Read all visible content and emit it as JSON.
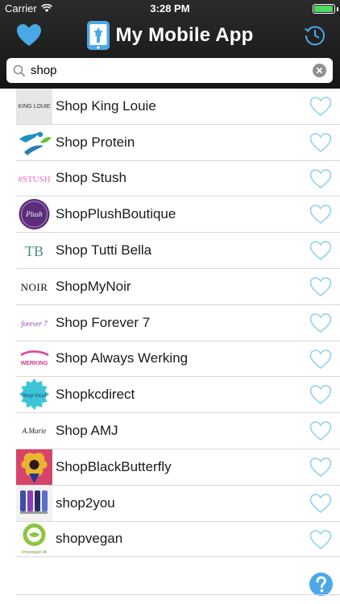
{
  "status": {
    "carrier": "Carrier",
    "time": "3:28 PM",
    "battery_level": 0.95
  },
  "header": {
    "title": "My Mobile App"
  },
  "search": {
    "value": "shop",
    "placeholder": ""
  },
  "results": [
    {
      "label": "Shop King Louie",
      "thumb_text": "KING LOUIE"
    },
    {
      "label": "Shop Protein",
      "thumb_text": ""
    },
    {
      "label": "Shop Stush",
      "thumb_text": "#STUSH"
    },
    {
      "label": "ShopPlushBoutique",
      "thumb_text": "Plush"
    },
    {
      "label": "Shop Tutti Bella",
      "thumb_text": "TB"
    },
    {
      "label": "ShopMyNoir",
      "thumb_text": "NOIR"
    },
    {
      "label": "Shop Forever 7",
      "thumb_text": "forever 7"
    },
    {
      "label": "Shop Always Werking",
      "thumb_text": "WERKING"
    },
    {
      "label": "Shopkcdirect",
      "thumb_text": "Shop local"
    },
    {
      "label": "Shop AMJ",
      "thumb_text": "A.Marie"
    },
    {
      "label": "ShopBlackButterfly",
      "thumb_text": ""
    },
    {
      "label": "shop2you",
      "thumb_text": ""
    },
    {
      "label": "shopvegan",
      "thumb_text": "shopvegan.dk"
    }
  ],
  "colors": {
    "accent": "#4aa8e6",
    "heart_outline": "#8fd0f0",
    "header_bg": "#1e1e1e"
  },
  "icons": {
    "favorites": "heart-icon",
    "history": "clock-history-icon",
    "search": "magnifier-icon",
    "clear": "clear-x-icon",
    "favorite_row": "heart-outline-icon",
    "help": "question-icon"
  }
}
